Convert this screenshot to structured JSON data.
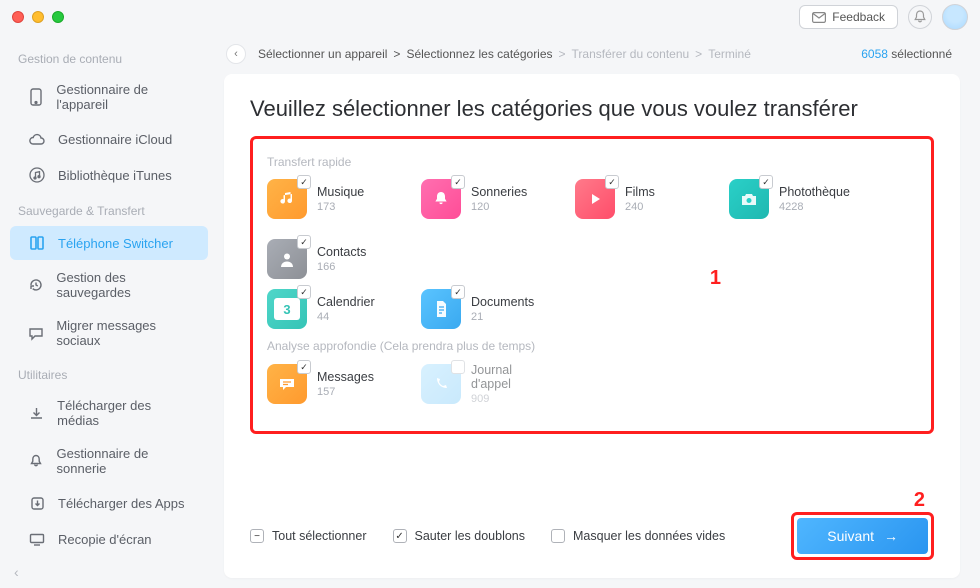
{
  "header": {
    "feedback": "Feedback"
  },
  "sidebar": {
    "groups": [
      {
        "head": "Gestion de contenu",
        "items": [
          {
            "label": "Gestionnaire de l'appareil"
          },
          {
            "label": "Gestionnaire iCloud"
          },
          {
            "label": "Bibliothèque iTunes"
          }
        ]
      },
      {
        "head": "Sauvegarde & Transfert",
        "items": [
          {
            "label": "Téléphone Switcher"
          },
          {
            "label": "Gestion des sauvegardes"
          },
          {
            "label": "Migrer messages sociaux"
          }
        ]
      },
      {
        "head": "Utilitaires",
        "items": [
          {
            "label": "Télécharger des médias"
          },
          {
            "label": "Gestionnaire de sonnerie"
          },
          {
            "label": "Télécharger des Apps"
          },
          {
            "label": "Recopie d'écran"
          }
        ]
      }
    ]
  },
  "crumbs": {
    "a": "Sélectionner un appareil",
    "b": "Sélectionnez les catégories",
    "c": "Transférer du contenu",
    "d": "Terminé",
    "sep": ">"
  },
  "selected": {
    "count": "6058",
    "label": "sélectionné"
  },
  "title": "Veuillez sélectionner les catégories que vous voulez transférer",
  "groups": {
    "rapid": "Transfert rapide",
    "deep": "Analyse approfondie (Cela prendra plus de temps)"
  },
  "cats": {
    "music": {
      "name": "Musique",
      "count": "173"
    },
    "ring": {
      "name": "Sonneries",
      "count": "120"
    },
    "films": {
      "name": "Films",
      "count": "240"
    },
    "photo": {
      "name": "Photothèque",
      "count": "4228"
    },
    "contact": {
      "name": "Contacts",
      "count": "166"
    },
    "cal": {
      "name": "Calendrier",
      "count": "44"
    },
    "doc": {
      "name": "Documents",
      "count": "21"
    },
    "msg": {
      "name": "Messages",
      "count": "157"
    },
    "call": {
      "name": "Journal d'appel",
      "count": "909"
    }
  },
  "footer": {
    "selectall": "Tout sélectionner",
    "skipdup": "Sauter les doublons",
    "hideempty": "Masquer les données vides",
    "next": "Suivant"
  },
  "annot": {
    "one": "1",
    "two": "2"
  }
}
